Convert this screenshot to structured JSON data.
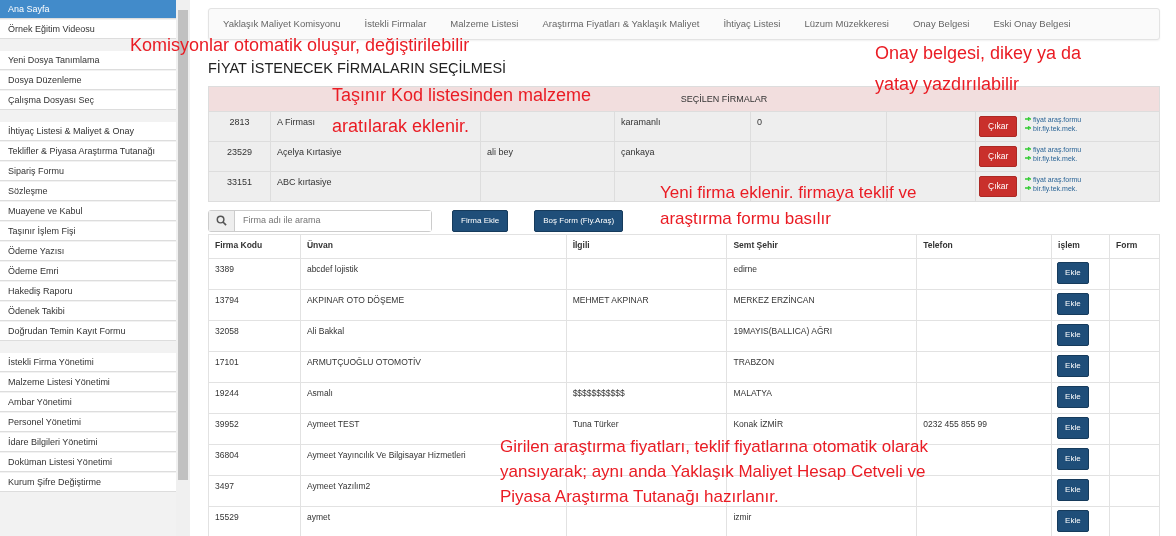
{
  "sidebar": {
    "groups": [
      [
        {
          "label": "Ana Sayfa",
          "selected": true
        },
        {
          "label": "Örnek Eğitim Videosu",
          "selected": false
        }
      ],
      [
        {
          "label": "Yeni Dosya Tanımlama",
          "selected": false
        },
        {
          "label": "Dosya Düzenleme",
          "selected": false
        },
        {
          "label": "Çalışma Dosyası Seç",
          "selected": false
        }
      ],
      [
        {
          "label": "İhtiyaç Listesi & Maliyet & Onay",
          "selected": false
        },
        {
          "label": "Teklifler & Piyasa Araştırma Tutanağı",
          "selected": false
        },
        {
          "label": "Sipariş Formu",
          "selected": false
        },
        {
          "label": "Sözleşme",
          "selected": false
        },
        {
          "label": "Muayene ve Kabul",
          "selected": false
        },
        {
          "label": "Taşınır İşlem Fişi",
          "selected": false
        },
        {
          "label": "Ödeme Yazısı",
          "selected": false
        },
        {
          "label": "Ödeme Emri",
          "selected": false
        },
        {
          "label": "Hakediş Raporu",
          "selected": false
        },
        {
          "label": "Ödenek Takibi",
          "selected": false
        },
        {
          "label": "Doğrudan Temin Kayıt Formu",
          "selected": false
        }
      ],
      [
        {
          "label": "İstekli Firma Yönetimi",
          "selected": false
        },
        {
          "label": "Malzeme Listesi Yönetimi",
          "selected": false
        },
        {
          "label": "Ambar Yönetimi",
          "selected": false
        },
        {
          "label": "Personel Yönetimi",
          "selected": false
        },
        {
          "label": "İdare Bilgileri Yönetimi",
          "selected": false
        },
        {
          "label": "Doküman Listesi Yönetimi",
          "selected": false
        },
        {
          "label": "Kurum Şifre Değiştirme",
          "selected": false
        }
      ]
    ]
  },
  "tabs": [
    {
      "label": "Yaklaşık Maliyet Komisyonu"
    },
    {
      "label": "İstekli Firmalar"
    },
    {
      "label": "Malzeme Listesi"
    },
    {
      "label": "Araştırma Fiyatları & Yaklaşık Maliyet"
    },
    {
      "label": "İhtiyaç Listesi"
    },
    {
      "label": "Lüzum Müzekkeresi"
    },
    {
      "label": "Onay Belgesi"
    },
    {
      "label": "Eski Onay Belgesi"
    }
  ],
  "heading": "FİYAT İSTENECEK FİRMALARIN SEÇİLMESİ",
  "selected_firms": {
    "title": "SEÇİLEN FİRMALAR",
    "rows": [
      {
        "cells": [
          "2813",
          "A Firması",
          "",
          "karamanlı",
          "0",
          ""
        ],
        "remove_label": "Çıkar",
        "links": [
          "fiyat araş.formu",
          "bir.fiy.tek.mek."
        ]
      },
      {
        "cells": [
          "23529",
          "Açelya Kırtasiye",
          "ali bey",
          "çankaya",
          "",
          ""
        ],
        "remove_label": "Çıkar",
        "links": [
          "fiyat araş.formu",
          "bir.fiy.tek.mek."
        ]
      },
      {
        "cells": [
          "33151",
          "ABC kırtasiye",
          "",
          "",
          "",
          ""
        ],
        "remove_label": "Çıkar",
        "links": [
          "fiyat araş.formu",
          "bir.fiy.tek.mek."
        ]
      }
    ]
  },
  "search": {
    "placeholder": "Firma adı ile arama"
  },
  "buttons": [
    "Firma Ekle",
    "Boş Form (Fiy.Araş)"
  ],
  "firms": {
    "columns": [
      "Firma Kodu",
      "Ünvan",
      "İlgili",
      "Semt Şehir",
      "Telefon",
      "işlem",
      "Form"
    ],
    "rows": [
      {
        "cells": [
          "3389",
          "abcdef lojistik",
          "",
          "edirne",
          ""
        ],
        "add_label": "Ekle"
      },
      {
        "cells": [
          "13794",
          "AKPINAR OTO DÖŞEME",
          "MEHMET AKPINAR",
          "MERKEZ ERZİNCAN",
          ""
        ],
        "add_label": "Ekle"
      },
      {
        "cells": [
          "32058",
          "Ali Bakkal",
          "",
          "19MAYIS(BALLICA) AĞRI",
          ""
        ],
        "add_label": "Ekle"
      },
      {
        "cells": [
          "17101",
          "ARMUTÇUOĞLU OTOMOTİV",
          "",
          "TRABZON",
          ""
        ],
        "add_label": "Ekle"
      },
      {
        "cells": [
          "19244",
          "Asmalı",
          "$$$$$$$$$$$",
          "MALATYA",
          ""
        ],
        "add_label": "Ekle"
      },
      {
        "cells": [
          "39952",
          "Aymeet TEST",
          "Tuna Türker",
          "Konak İZMİR",
          "0232 455 855 99"
        ],
        "add_label": "Ekle"
      },
      {
        "cells": [
          "36804",
          "Aymeet Yayıncılık Ve Bilgisayar Hizmetleri",
          "",
          "",
          ""
        ],
        "add_label": "Ekle"
      },
      {
        "cells": [
          "3497",
          "Aymeet Yazılım2",
          "",
          "",
          ""
        ],
        "add_label": "Ekle"
      },
      {
        "cells": [
          "15529",
          "aymet",
          "",
          "izmir",
          ""
        ],
        "add_label": "Ekle"
      }
    ]
  },
  "annotations": [
    {
      "lines": [
        "Komisyonlar otomatik oluşur, değiştirilebilir"
      ]
    },
    {
      "lines": [
        "Onay belgesi, dikey ya da",
        "yatay yazdırılabilir"
      ]
    },
    {
      "lines": [
        "Taşınır Kod listesinden malzeme",
        "aratılarak eklenir."
      ]
    },
    {
      "lines": [
        "Yeni firma eklenir. firmaya teklif ve",
        "araştırma formu basılır"
      ]
    },
    {
      "lines": [
        "Girilen araştırma fiyatları, teklif fiyatlarına otomatik olarak",
        "yansıyarak; aynı anda Yaklaşık Maliyet Hesap Cetveli ve",
        "Piyasa Araştırma Tutanağı hazırlanır."
      ]
    }
  ]
}
